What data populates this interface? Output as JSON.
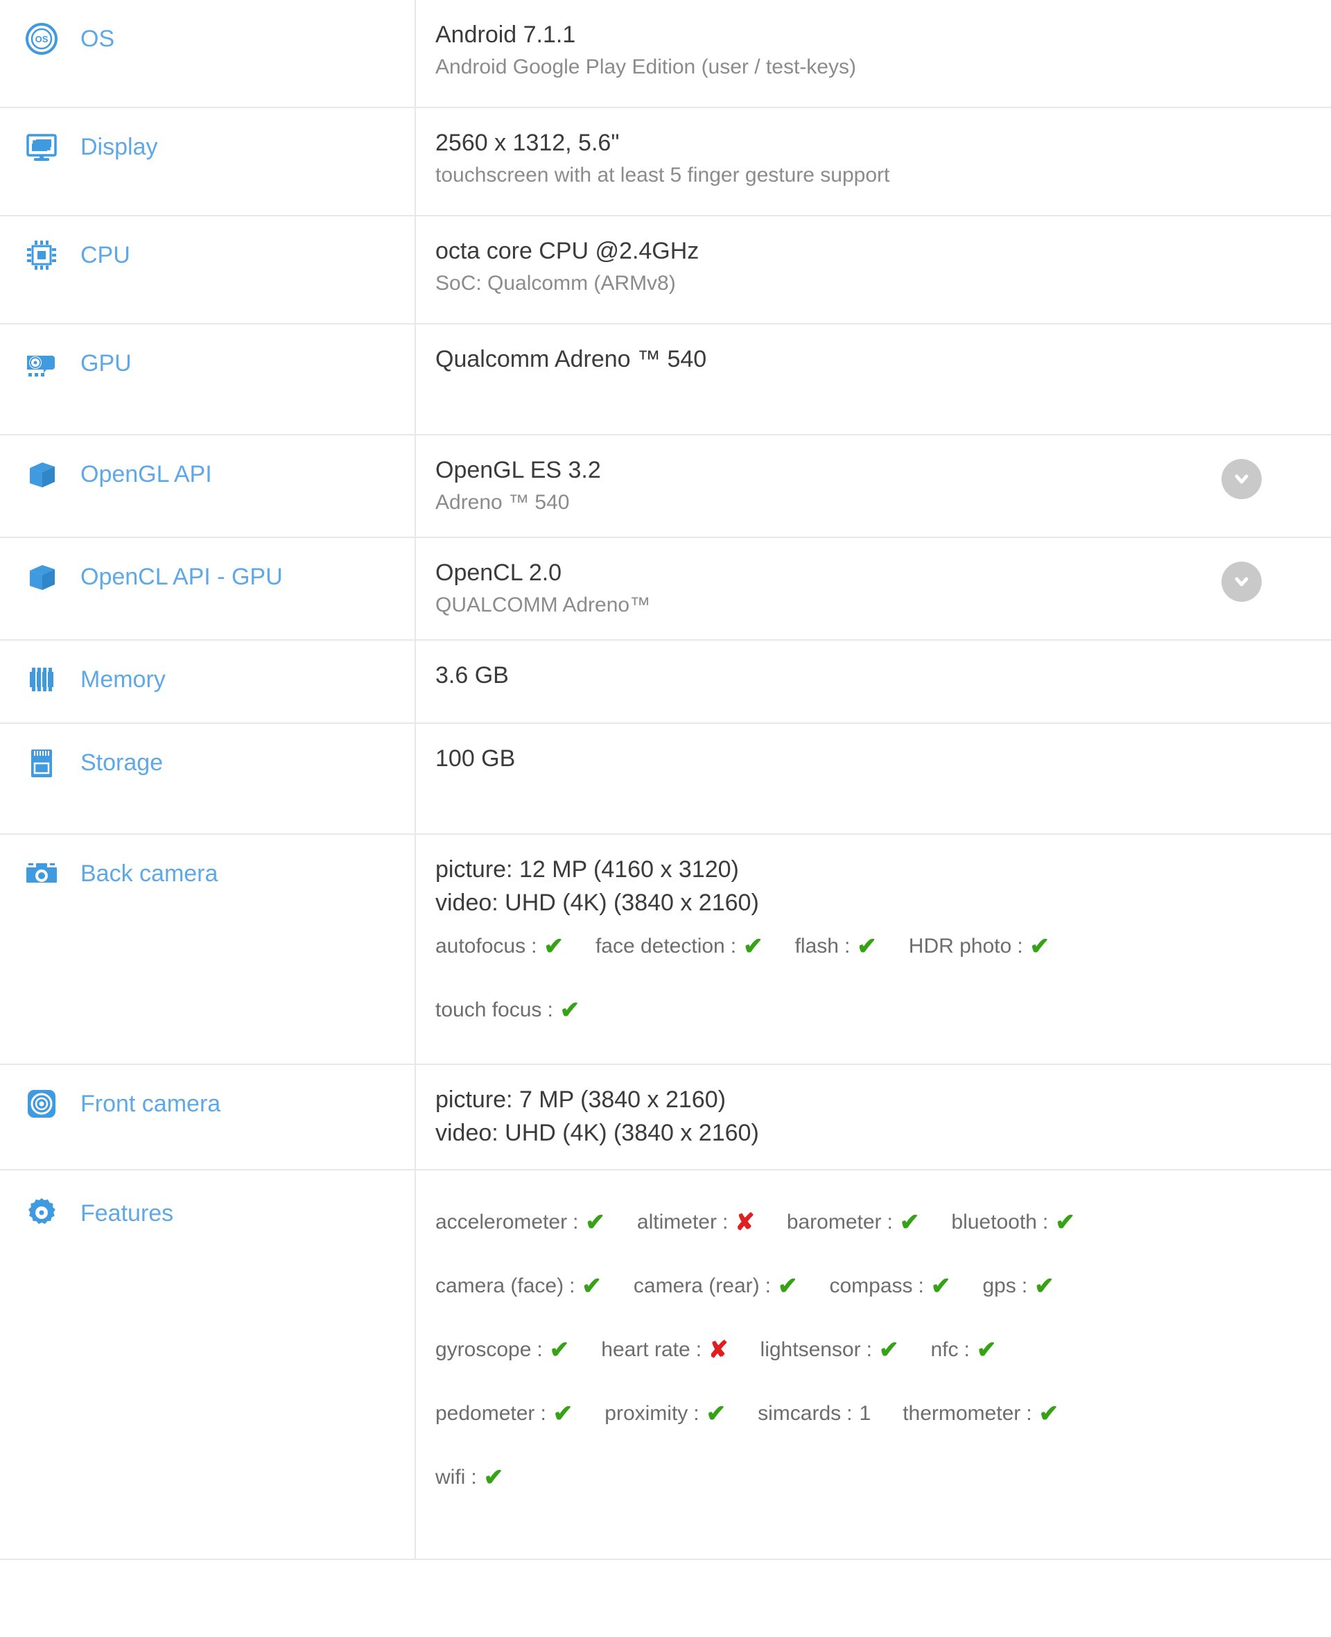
{
  "rows": [
    {
      "id": "os",
      "icon": "os-icon",
      "label": "OS",
      "value_main": "Android 7.1.1",
      "value_sub": "Android Google Play Edition (user / test-keys)"
    },
    {
      "id": "display",
      "icon": "display-icon",
      "label": "Display",
      "value_main": "2560 x 1312, 5.6\"",
      "value_sub": "touchscreen with at least 5 finger gesture support"
    },
    {
      "id": "cpu",
      "icon": "cpu-icon",
      "label": "CPU",
      "value_main": "octa core CPU @2.4GHz",
      "value_sub": "SoC: Qualcomm (ARMv8)"
    },
    {
      "id": "gpu",
      "icon": "gpu-icon",
      "label": "GPU",
      "value_main": "Qualcomm Adreno ™ 540",
      "value_sub": ""
    },
    {
      "id": "opengl",
      "icon": "cube-icon",
      "label": "OpenGL API",
      "value_main": "OpenGL ES 3.2",
      "value_sub": "Adreno ™ 540",
      "expander": "chevron-down-icon"
    },
    {
      "id": "opencl",
      "icon": "cube-icon",
      "label": "OpenCL API - GPU",
      "value_main": "OpenCL 2.0",
      "value_sub": "QUALCOMM Adreno™",
      "expander": "chevron-down-icon"
    },
    {
      "id": "memory",
      "icon": "memory-icon",
      "label": "Memory",
      "value_main": "3.6 GB",
      "value_sub": ""
    },
    {
      "id": "storage",
      "icon": "storage-icon",
      "label": "Storage",
      "value_main": "100 GB",
      "value_sub": ""
    }
  ],
  "back_camera": {
    "icon": "back-camera-icon",
    "label": "Back camera",
    "picture": "picture: 12 MP (4160 x 3120)",
    "video": "video: UHD (4K) (3840 x 2160)",
    "flags_line1": [
      {
        "name": "autofocus",
        "mark": "yes"
      },
      {
        "name": "face detection",
        "mark": "yes"
      },
      {
        "name": "flash",
        "mark": "yes"
      },
      {
        "name": "HDR photo",
        "mark": "yes"
      }
    ],
    "flags_line2": [
      {
        "name": "touch focus",
        "mark": "yes"
      }
    ]
  },
  "front_camera": {
    "icon": "front-camera-icon",
    "label": "Front camera",
    "picture": "picture: 7 MP (3840 x 2160)",
    "video": "video: UHD (4K) (3840 x 2160)"
  },
  "features": {
    "icon": "gear-icon",
    "label": "Features",
    "lines": [
      [
        {
          "name": "accelerometer",
          "mark": "yes"
        },
        {
          "name": "altimeter",
          "mark": "no"
        },
        {
          "name": "barometer",
          "mark": "yes"
        },
        {
          "name": "bluetooth",
          "mark": "yes"
        }
      ],
      [
        {
          "name": "camera (face)",
          "mark": "yes"
        },
        {
          "name": "camera (rear)",
          "mark": "yes"
        },
        {
          "name": "compass",
          "mark": "yes"
        },
        {
          "name": "gps",
          "mark": "yes"
        }
      ],
      [
        {
          "name": "gyroscope",
          "mark": "yes"
        },
        {
          "name": "heart rate",
          "mark": "no"
        },
        {
          "name": "lightsensor",
          "mark": "yes"
        },
        {
          "name": "nfc",
          "mark": "yes"
        }
      ],
      [
        {
          "name": "pedometer",
          "mark": "yes"
        },
        {
          "name": "proximity",
          "mark": "yes"
        },
        {
          "name": "simcards",
          "mark": "value",
          "value": "1"
        },
        {
          "name": "thermometer",
          "mark": "yes"
        }
      ],
      [
        {
          "name": "wifi",
          "mark": "yes"
        }
      ]
    ]
  },
  "glyphs": {
    "check": "✔",
    "cross": "✘",
    "separator": ":"
  },
  "colors": {
    "label_blue": "#5fa8e8",
    "icon_blue": "#3f9ae0",
    "value_dark": "#3b3b3b",
    "value_gray": "#8b8b8b",
    "check_green": "#36a215",
    "cross_red": "#e02020",
    "border_gray": "#e8e8e8",
    "chevron_gray": "#c9c9c9"
  }
}
